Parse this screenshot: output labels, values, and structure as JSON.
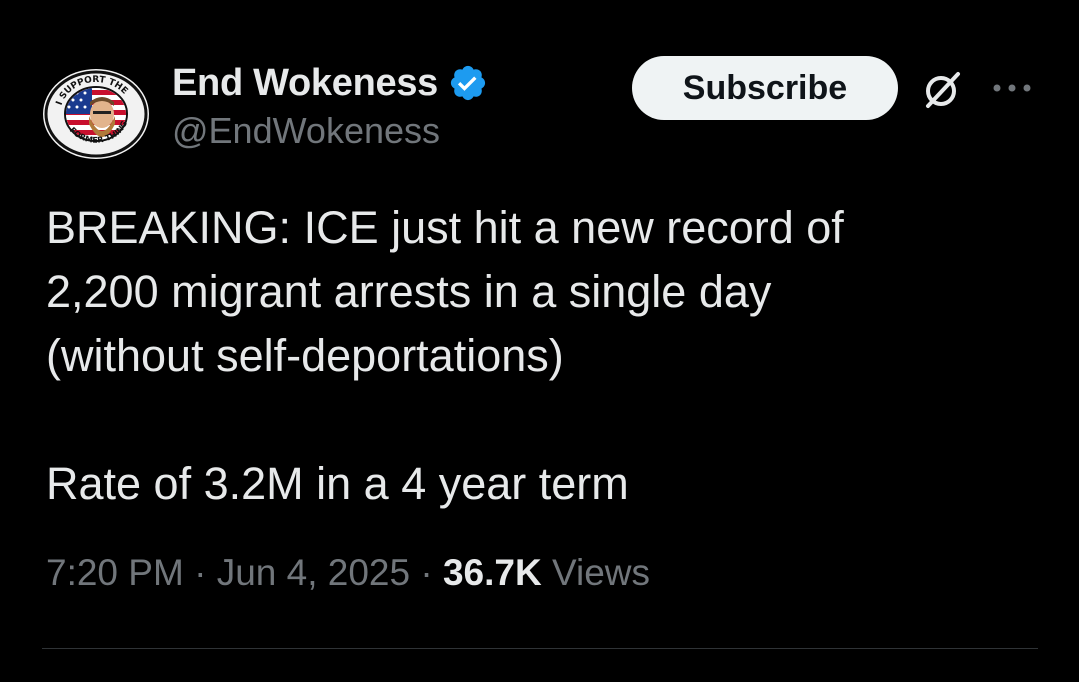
{
  "author": {
    "display_name": "End Wokeness",
    "handle": "@EndWokeness",
    "verified": true,
    "avatar_icon": "support-the-former-thing-patch-avatar",
    "avatar_text_top": "I SUPPORT THE",
    "avatar_text_bottom": "FORMER THING"
  },
  "actions": {
    "subscribe_label": "Subscribe",
    "grok_icon": "grok-icon",
    "more_icon": "more-dots-icon"
  },
  "tweet": {
    "lines": [
      "BREAKING: ICE just hit a new record of",
      "2,200 migrant arrests in a single day",
      "(without self-deportations)"
    ],
    "second_paragraph": "Rate of 3.2M in a 4 year term"
  },
  "meta": {
    "time": "7:20 PM",
    "separator": "·",
    "date": "Jun 4, 2025",
    "views_count": "36.7K",
    "views_label": "Views"
  },
  "colors": {
    "background": "#000000",
    "primary_text": "#e7e9ea",
    "secondary_text": "#71767b",
    "verified_badge": "#1d9bf0",
    "button_bg": "#eff3f4",
    "button_text": "#0f1419",
    "divider": "#2f3336"
  }
}
